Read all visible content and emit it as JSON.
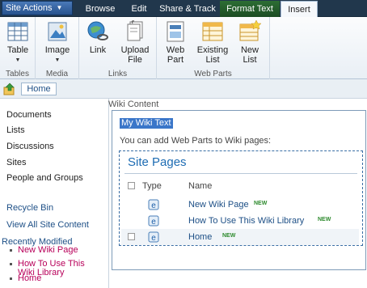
{
  "topbar": {
    "site_actions": "Site Actions",
    "tabs": [
      "Browse",
      "Edit",
      "Share & Track",
      "Format Text",
      "Insert"
    ]
  },
  "ribbon": {
    "groups": [
      {
        "label": "Tables",
        "buttons": [
          "Table"
        ]
      },
      {
        "label": "Media",
        "buttons": [
          "Image"
        ]
      },
      {
        "label": "Links",
        "buttons": [
          "Link",
          "Upload File"
        ]
      },
      {
        "label": "Web Parts",
        "buttons": [
          "Web Part",
          "Existing List",
          "New List"
        ]
      }
    ]
  },
  "breadcrumb": {
    "home": "Home"
  },
  "leftnav": {
    "headings": [
      "Documents",
      "Lists",
      "Discussions",
      "Sites",
      "People and Groups"
    ],
    "links": [
      "Recycle Bin",
      "View All Site Content"
    ],
    "recent_title": "Recently Modified",
    "recent_items": [
      "New Wiki Page",
      "How To Use This Wiki Library",
      "Home"
    ]
  },
  "content": {
    "label": "Wiki Content",
    "selected_text": "My Wiki Text",
    "hint": "You can add Web Parts to Wiki pages:",
    "webpart": {
      "title": "Site Pages",
      "columns": [
        "Type",
        "Name"
      ],
      "rows": [
        {
          "name": "New Wiki Page",
          "badge": "NEW"
        },
        {
          "name": "How To Use This Wiki Library",
          "badge": "NEW"
        },
        {
          "name": "Home",
          "badge": "NEW"
        }
      ]
    }
  },
  "colors": {
    "topbar": "#21374c",
    "link": "#1d4f86",
    "recent": "#b8005a",
    "selection": "#3a76c9",
    "webpart_title": "#1d6cb3",
    "new_badge": "#2d8a2d"
  }
}
